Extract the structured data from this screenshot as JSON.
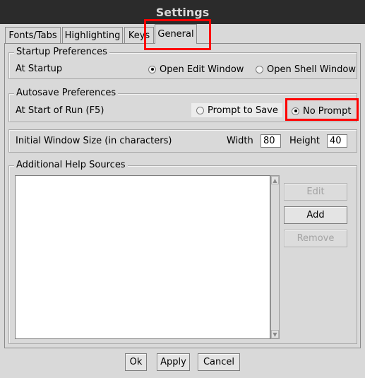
{
  "window": {
    "title": "Settings"
  },
  "tabs": [
    {
      "label": "Fonts/Tabs"
    },
    {
      "label": "Highlighting"
    },
    {
      "label": "Keys"
    },
    {
      "label": "General",
      "selected": true
    }
  ],
  "startup": {
    "title": "Startup Preferences",
    "label": "At Startup",
    "options": [
      {
        "label": "Open Edit Window",
        "selected": true
      },
      {
        "label": "Open Shell Window",
        "selected": false
      }
    ]
  },
  "autosave": {
    "title": "Autosave Preferences",
    "label": "At Start of Run (F5)",
    "options": [
      {
        "label": "Prompt to Save",
        "selected": false
      },
      {
        "label": "No Prompt",
        "selected": true
      }
    ]
  },
  "window_size": {
    "label": "Initial Window Size  (in characters)",
    "width_label": "Width",
    "width_value": "80",
    "height_label": "Height",
    "height_value": "40"
  },
  "help_sources": {
    "title": "Additional Help Sources",
    "buttons": [
      {
        "label": "Edit",
        "enabled": false
      },
      {
        "label": "Add",
        "enabled": true
      },
      {
        "label": "Remove",
        "enabled": false
      }
    ]
  },
  "footer": {
    "buttons": [
      {
        "label": "Ok"
      },
      {
        "label": "Apply"
      },
      {
        "label": "Cancel"
      }
    ]
  },
  "colors": {
    "highlight": "#ff0000",
    "titlebar": "#2b2b2b"
  }
}
